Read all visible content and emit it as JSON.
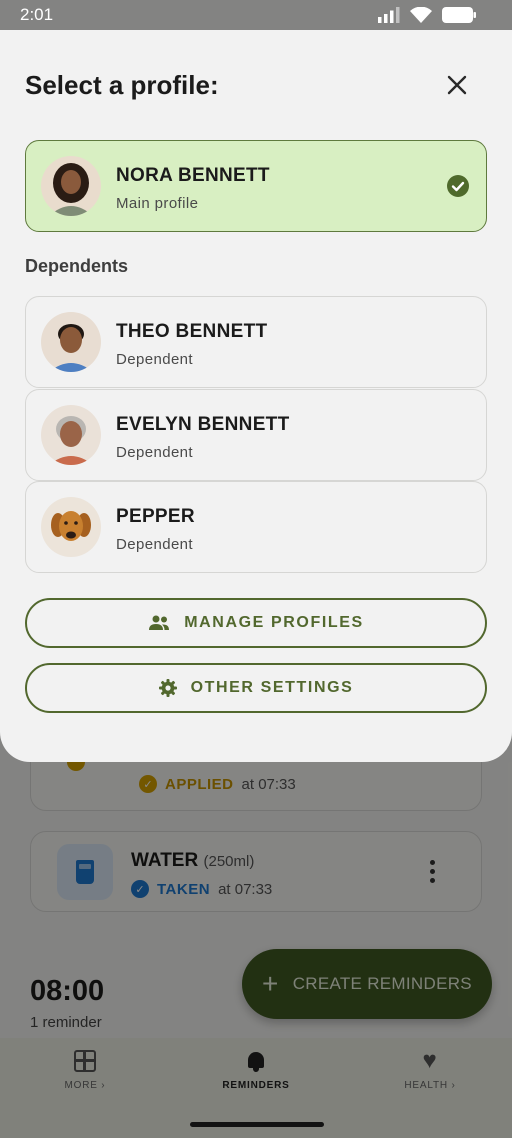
{
  "status_bar": {
    "time": "2:01"
  },
  "sheet": {
    "title": "Select a profile:",
    "main_profile": {
      "name": "NORA BENNETT",
      "subtitle": "Main profile",
      "selected": true
    },
    "dependents_label": "Dependents",
    "dependents": [
      {
        "name": "THEO BENNETT",
        "subtitle": "Dependent"
      },
      {
        "name": "EVELYN BENNETT",
        "subtitle": "Dependent"
      },
      {
        "name": "PEPPER",
        "subtitle": "Dependent"
      }
    ],
    "manage_button": "MANAGE PROFILES",
    "settings_button": "OTHER SETTINGS"
  },
  "background": {
    "card1": {
      "status": "APPLIED",
      "time_text": "at 07:33"
    },
    "card2": {
      "title": "WATER",
      "amount": "(250ml)",
      "status": "TAKEN",
      "time_text": "at 07:33"
    },
    "time_heading": "08:00",
    "reminder_count": "1 reminder",
    "fab_label": "CREATE REMINDERS",
    "nav": {
      "more": "MORE ›",
      "reminders": "REMINDERS",
      "health": "HEALTH ›"
    }
  },
  "colors": {
    "accent": "#52682e",
    "selected_bg": "#d8efc2",
    "applied": "#c69400",
    "taken": "#1e78d0",
    "fab": "#3f5a22"
  }
}
